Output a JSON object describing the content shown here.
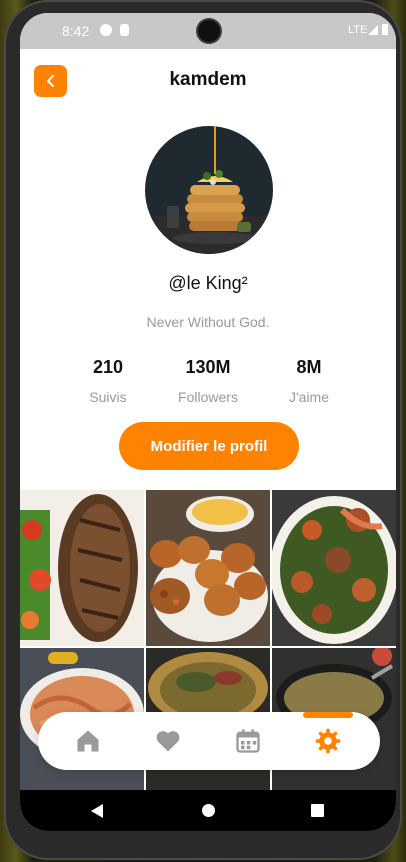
{
  "status_bar": {
    "time": "8:42",
    "network": "LTE"
  },
  "header": {
    "title": "kamdem",
    "back_icon": "chevron-left-icon"
  },
  "profile": {
    "handle": "@le King²",
    "bio": "Never Without God.",
    "stats": [
      {
        "value": "210",
        "label": "Suivis"
      },
      {
        "value": "130M",
        "label": "Followers"
      },
      {
        "value": "8M",
        "label": "J'aime"
      }
    ],
    "edit_button": "Modifier le profil"
  },
  "posts": [
    {
      "name": "grilled-fish-photo"
    },
    {
      "name": "puff-puff-photo"
    },
    {
      "name": "seafood-stew-photo"
    },
    {
      "name": "shrimp-noodles-photo"
    },
    {
      "name": "fish-sauce-photo"
    },
    {
      "name": "greens-dish-photo"
    }
  ],
  "bottom_nav": {
    "items": [
      "home-icon",
      "heart-icon",
      "calendar-icon",
      "settings-icon"
    ],
    "active": "settings-icon"
  },
  "colors": {
    "accent": "#ff8300",
    "muted": "#9a9a9a",
    "text": "#111111"
  }
}
